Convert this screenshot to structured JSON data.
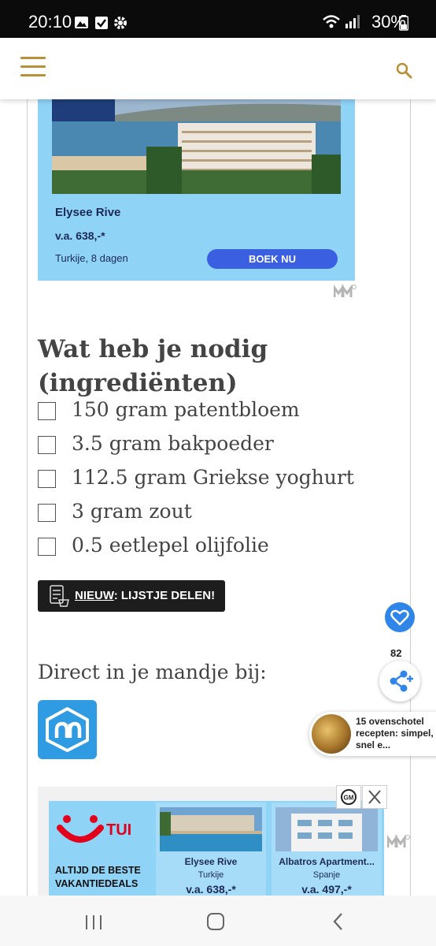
{
  "status_bar": {
    "time": "20:10",
    "battery": "30%"
  },
  "ad_top": {
    "hotel_name": "Elysee Rive",
    "price": "v.a. 638,-*",
    "destination": "Turkije, 8 dagen",
    "button_label": "BOEK NU"
  },
  "ingredients": {
    "heading_line1": "Wat heb je nodig",
    "heading_line2": "(ingrediënten)",
    "items": [
      "150 gram patentbloem",
      "3.5 gram bakpoeder",
      "112.5 gram Griekse yoghurt",
      "3 gram zout",
      "0.5 eetlepel olijfolie"
    ]
  },
  "share_list": {
    "new_label": "NIEUW",
    "rest_label": ": LIJSTJE DELEN!"
  },
  "direct_label": "Direct in je mandje bij:",
  "favorites_count": "82",
  "recommendation": {
    "text": "15 ovenschotel recepten: simpel, snel e..."
  },
  "ad_bottom": {
    "brand": "TUI",
    "slogan": "ALTIJD DE BESTE VAKANTIEDEALS",
    "cards": [
      {
        "name": "Elysee Rive",
        "country": "Turkije",
        "price": "v.a. 638,-*"
      },
      {
        "name": "Albatros Apartment...",
        "country": "Spanje",
        "price": "v.a. 497,-*"
      }
    ]
  },
  "icons": [
    "hamburger-menu-icon",
    "search-icon",
    "checklist-icon",
    "albert-heijn-logo",
    "heart-icon",
    "share-icon",
    "close-icon"
  ],
  "colors": {
    "accent_gold": "#b8903a",
    "ad_blue": "#8fd3f6",
    "button_blue": "#3a5fe0",
    "heart_blue": "#2f86e8",
    "ah_blue": "#2f9be3",
    "tui_red": "#e2001a"
  }
}
